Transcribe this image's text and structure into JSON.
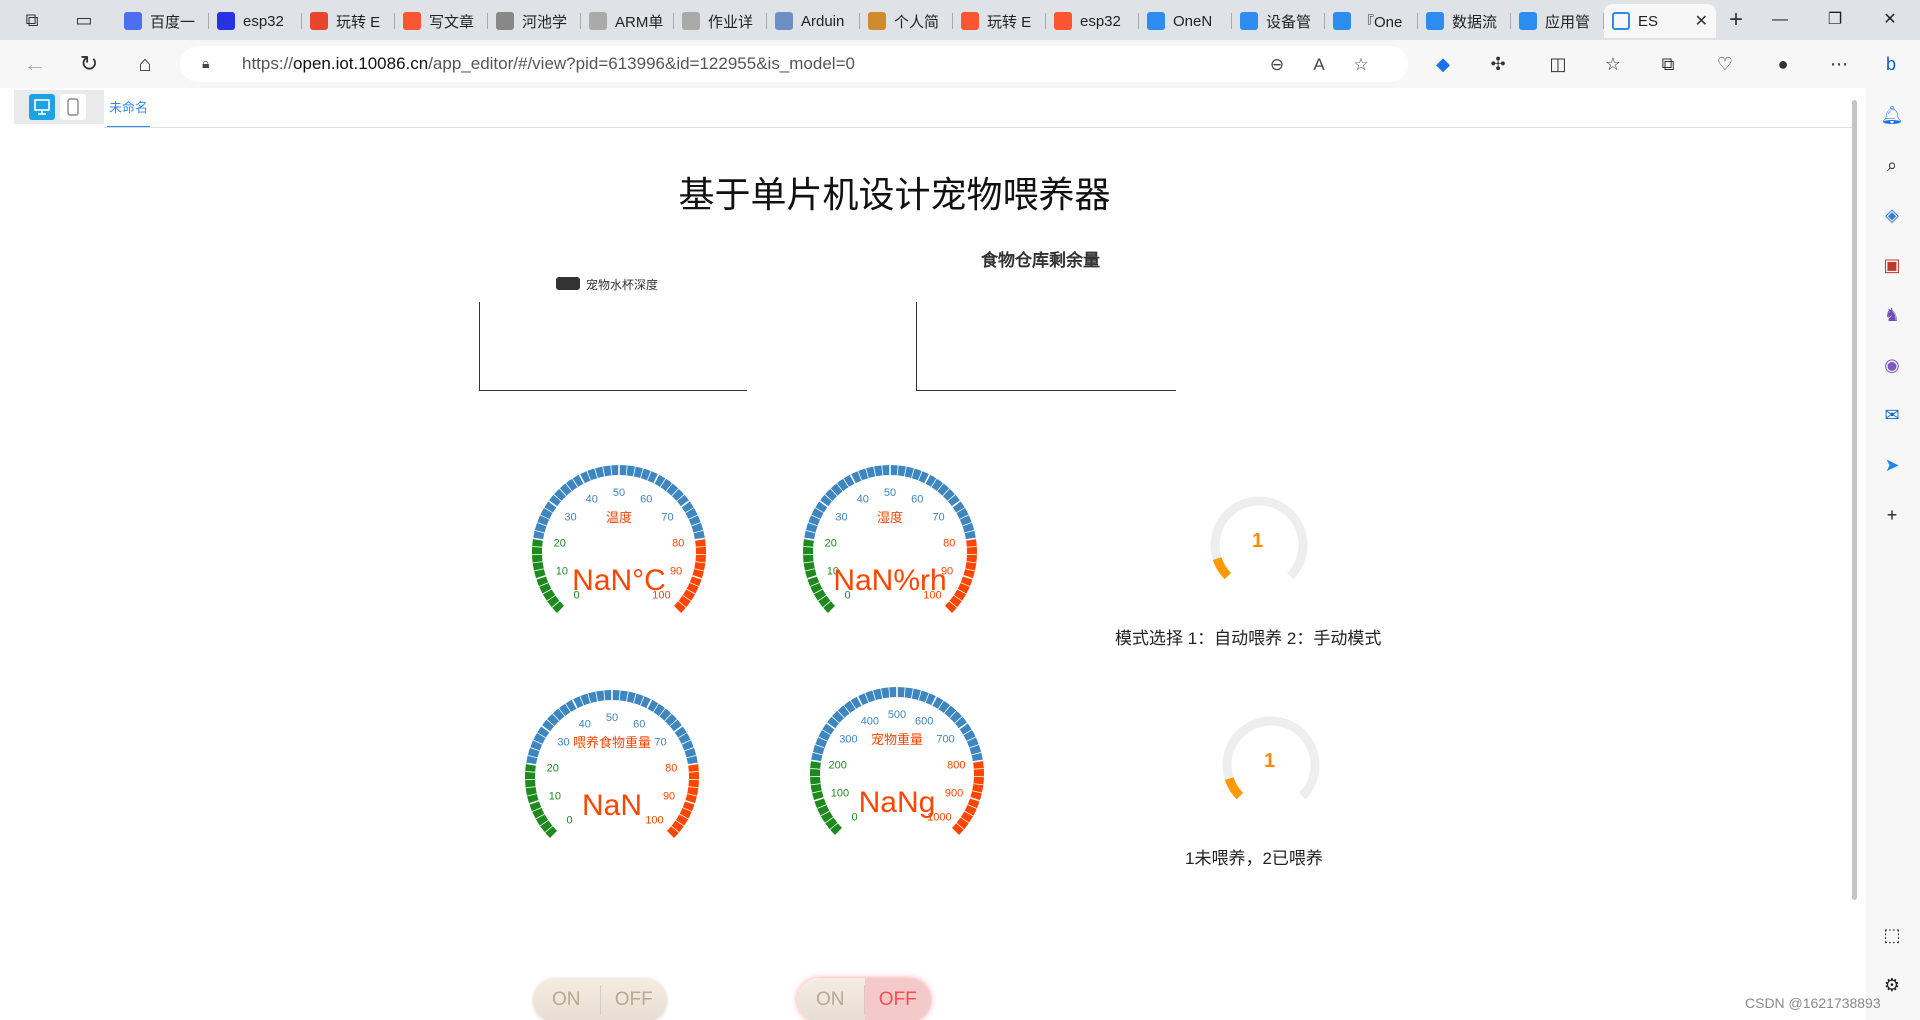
{
  "browser": {
    "tabs": [
      {
        "label": "百度一",
        "color": "#4e6ef2"
      },
      {
        "label": "esp32",
        "color": "#2932e1"
      },
      {
        "label": "玩转 E",
        "color": "#e8462c"
      },
      {
        "label": "写文章",
        "color": "#fc5531"
      },
      {
        "label": "河池学",
        "color": "#888888"
      },
      {
        "label": "ARM单",
        "color": "#aaaaaa"
      },
      {
        "label": "作业详",
        "color": "#aaaaaa"
      },
      {
        "label": "Arduin",
        "color": "#6b8fc4"
      },
      {
        "label": "个人简",
        "color": "#d08c2c"
      },
      {
        "label": "玩转 E",
        "color": "#fc5531"
      },
      {
        "label": "esp32",
        "color": "#fc5531"
      },
      {
        "label": "OneN",
        "color": "#2d8cf0"
      },
      {
        "label": "设备管",
        "color": "#2d8cf0"
      },
      {
        "label": "『One",
        "color": "#2d8cf0"
      },
      {
        "label": "数据流",
        "color": "#2d8cf0"
      },
      {
        "label": "应用管",
        "color": "#2d8cf0"
      }
    ],
    "active_tab": {
      "label": "ES",
      "color": "#2d8cf0"
    },
    "url_prefix": "https://",
    "url_host": "open.iot.10086.cn",
    "url_path": "/app_editor/#/view?pid=613996&id=122955&is_model=0"
  },
  "editor": {
    "tab_label": "未命名"
  },
  "app": {
    "title": "基于单片机设计宠物喂养器",
    "charts": [
      {
        "title": "",
        "legend": "宠物水杯深度"
      },
      {
        "title": "食物仓库剩余量",
        "legend": ""
      }
    ],
    "gauges": [
      {
        "label": "温度",
        "value_text": "NaN°C",
        "min": 0,
        "max": 100,
        "ticks": [
          "0",
          "10",
          "20",
          "30",
          "40",
          "50",
          "60",
          "70",
          "80",
          "90",
          "100"
        ]
      },
      {
        "label": "湿度",
        "value_text": "NaN%rh",
        "min": 0,
        "max": 100,
        "ticks": [
          "0",
          "10",
          "20",
          "30",
          "40",
          "50",
          "60",
          "70",
          "80",
          "90",
          "100"
        ]
      },
      {
        "label": "喂养食物重量",
        "value_text": "NaN",
        "min": 0,
        "max": 100,
        "ticks": [
          "0",
          "10",
          "20",
          "30",
          "40",
          "50",
          "60",
          "70",
          "80",
          "90",
          "100"
        ]
      },
      {
        "label": "宠物重量",
        "value_text": "NaNg",
        "min": 0,
        "max": 1000,
        "ticks": [
          "0",
          "100",
          "200",
          "300",
          "400",
          "500",
          "600",
          "700",
          "800",
          "900",
          "1000"
        ]
      }
    ],
    "rings": [
      {
        "value": "1",
        "fraction": 0.1,
        "label": "模式选择 1：自动喂养 2：手动模式"
      },
      {
        "value": "1",
        "fraction": 0.1,
        "label": "1未喂养，2已喂养"
      }
    ],
    "switches": [
      {
        "on": "ON",
        "off": "OFF",
        "state": "off"
      },
      {
        "on": "ON",
        "off": "OFF",
        "state": "off"
      }
    ]
  },
  "watermark": "CSDN @1621738893",
  "colors": {
    "gauge_blue": "#3e86c0",
    "gauge_green": "#1e8a1e",
    "gauge_red": "#ff4500",
    "ring_orange": "#ff9900",
    "accent": "#2d8cf0"
  }
}
